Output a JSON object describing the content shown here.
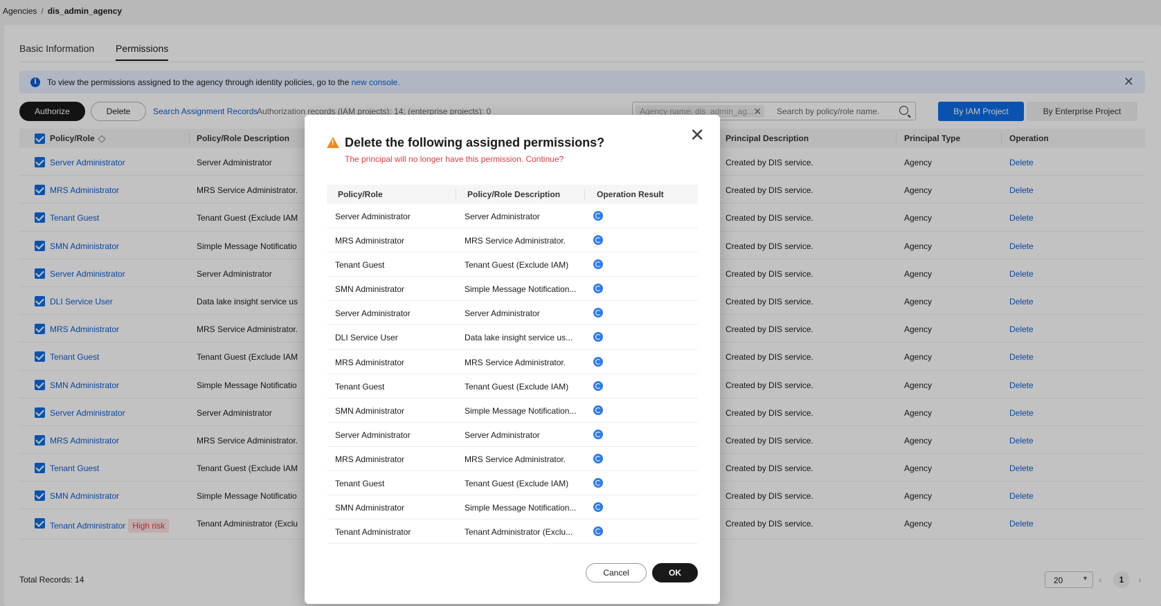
{
  "breadcrumb": {
    "parent": "Agencies",
    "separator": "/",
    "current": "dis_admin_agency"
  },
  "tabs": [
    {
      "label": "Basic Information"
    },
    {
      "label": "Permissions"
    }
  ],
  "notice": {
    "text": "To view the permissions assigned to the agency through identity policies, go to the",
    "link": "new console."
  },
  "toolbar": {
    "authorize_label": "Authorize",
    "delete_label": "Delete",
    "search_records_label": "Search Assignment Records",
    "records_text": "Authorization records (IAM projects): 14; (enterprise projects): 0",
    "search_chip": "Agency name: dis_admin_ag...",
    "search_placeholder": "Search by policy/role name.",
    "by_iam_label": "By IAM Project",
    "by_enterprise_label": "By Enterprise Project"
  },
  "table": {
    "headers": {
      "policy": "Policy/Role",
      "description": "Policy/Role Description",
      "principal_desc": "Principal Description",
      "principal_type": "Principal Type",
      "operation": "Operation"
    },
    "rows": [
      {
        "policy": "Server Administrator",
        "description": "Server Administrator",
        "principal_desc": "Created by DIS service.",
        "principal_type": "Agency",
        "operation": "Delete",
        "risk": ""
      },
      {
        "policy": "MRS Administrator",
        "description": "MRS Service Administrator.",
        "principal_desc": "Created by DIS service.",
        "principal_type": "Agency",
        "operation": "Delete",
        "risk": ""
      },
      {
        "policy": "Tenant Guest",
        "description": "Tenant Guest (Exclude IAM",
        "principal_desc": "Created by DIS service.",
        "principal_type": "Agency",
        "operation": "Delete",
        "risk": ""
      },
      {
        "policy": "SMN Administrator",
        "description": "Simple Message Notificatio",
        "principal_desc": "Created by DIS service.",
        "principal_type": "Agency",
        "operation": "Delete",
        "risk": ""
      },
      {
        "policy": "Server Administrator",
        "description": "Server Administrator",
        "principal_desc": "Created by DIS service.",
        "principal_type": "Agency",
        "operation": "Delete",
        "risk": ""
      },
      {
        "policy": "DLI Service User",
        "description": "Data lake insight service us",
        "principal_desc": "Created by DIS service.",
        "principal_type": "Agency",
        "operation": "Delete",
        "risk": ""
      },
      {
        "policy": "MRS Administrator",
        "description": "MRS Service Administrator.",
        "principal_desc": "Created by DIS service.",
        "principal_type": "Agency",
        "operation": "Delete",
        "risk": ""
      },
      {
        "policy": "Tenant Guest",
        "description": "Tenant Guest (Exclude IAM",
        "principal_desc": "Created by DIS service.",
        "principal_type": "Agency",
        "operation": "Delete",
        "risk": ""
      },
      {
        "policy": "SMN Administrator",
        "description": "Simple Message Notificatio",
        "principal_desc": "Created by DIS service.",
        "principal_type": "Agency",
        "operation": "Delete",
        "risk": ""
      },
      {
        "policy": "Server Administrator",
        "description": "Server Administrator",
        "principal_desc": "Created by DIS service.",
        "principal_type": "Agency",
        "operation": "Delete",
        "risk": ""
      },
      {
        "policy": "MRS Administrator",
        "description": "MRS Service Administrator.",
        "principal_desc": "Created by DIS service.",
        "principal_type": "Agency",
        "operation": "Delete",
        "risk": ""
      },
      {
        "policy": "Tenant Guest",
        "description": "Tenant Guest (Exclude IAM",
        "principal_desc": "Created by DIS service.",
        "principal_type": "Agency",
        "operation": "Delete",
        "risk": ""
      },
      {
        "policy": "SMN Administrator",
        "description": "Simple Message Notificatio",
        "principal_desc": "Created by DIS service.",
        "principal_type": "Agency",
        "operation": "Delete",
        "risk": ""
      },
      {
        "policy": "Tenant Administrator",
        "description": "Tenant Administrator (Exclu",
        "principal_desc": "Created by DIS service.",
        "principal_type": "Agency",
        "operation": "Delete",
        "risk": "High risk"
      }
    ]
  },
  "footer": {
    "total": "Total Records: 14",
    "page_size": "20",
    "page": "1"
  },
  "modal": {
    "title": "Delete the following assigned permissions?",
    "subtitle": "The principal will no longer have this permission. Continue?",
    "headers": {
      "policy": "Policy/Role",
      "description": "Policy/Role Description",
      "result": "Operation Result"
    },
    "rows": [
      {
        "policy": "Server Administrator",
        "description": "Server Administrator"
      },
      {
        "policy": "MRS Administrator",
        "description": "MRS Service Administrator."
      },
      {
        "policy": "Tenant Guest",
        "description": "Tenant Guest (Exclude IAM)"
      },
      {
        "policy": "SMN Administrator",
        "description": "Simple Message Notification..."
      },
      {
        "policy": "Server Administrator",
        "description": "Server Administrator"
      },
      {
        "policy": "DLI Service User",
        "description": "Data lake insight service us..."
      },
      {
        "policy": "MRS Administrator",
        "description": "MRS Service Administrator."
      },
      {
        "policy": "Tenant Guest",
        "description": "Tenant Guest (Exclude IAM)"
      },
      {
        "policy": "SMN Administrator",
        "description": "Simple Message Notification..."
      },
      {
        "policy": "Server Administrator",
        "description": "Server Administrator"
      },
      {
        "policy": "MRS Administrator",
        "description": "MRS Service Administrator."
      },
      {
        "policy": "Tenant Guest",
        "description": "Tenant Guest (Exclude IAM)"
      },
      {
        "policy": "SMN Administrator",
        "description": "Simple Message Notification..."
      },
      {
        "policy": "Tenant Administrator",
        "description": "Tenant Administrator (Exclu..."
      }
    ],
    "cancel_label": "Cancel",
    "ok_label": "OK"
  },
  "colors": {
    "accent": "#0d6ee6",
    "link": "#0d5cd1",
    "danger": "#e03c3c",
    "warning": "#f28a1b"
  }
}
